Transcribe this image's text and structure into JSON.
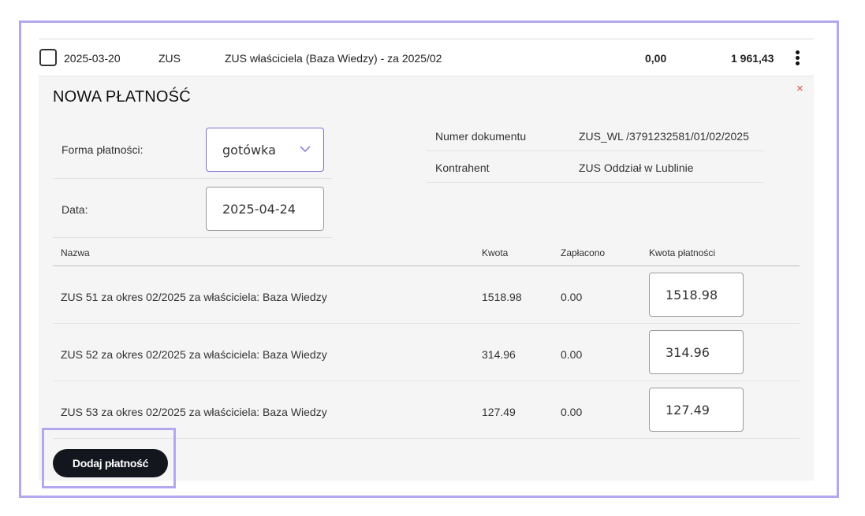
{
  "row": {
    "date": "2025-03-20",
    "type": "ZUS",
    "description": "ZUS właściciela (Baza Wiedzy) - za 2025/02",
    "paid": "0,00",
    "amount": "1 961,43"
  },
  "panel": {
    "title": "NOWA PŁATNOŚĆ",
    "close": "×",
    "payment_form_label": "Forma płatności:",
    "payment_form_value": "gotówka",
    "date_label": "Data:",
    "date_value": "2025-04-24",
    "doc_number_label": "Numer dokumentu",
    "doc_number_value": "ZUS_WL /3791232581/01/02/2025",
    "contractor_label": "Kontrahent",
    "contractor_value": "ZUS Oddział w Lublinie"
  },
  "table": {
    "headers": [
      "Nazwa",
      "Kwota",
      "Zapłacono",
      "Kwota płatności"
    ],
    "rows": [
      {
        "name": "ZUS 51 za okres 02/2025 za właściciela: Baza Wiedzy",
        "amount": "1518.98",
        "paid": "0.00",
        "payment": "1518.98"
      },
      {
        "name": "ZUS 52 za okres 02/2025 za właściciela: Baza Wiedzy",
        "amount": "314.96",
        "paid": "0.00",
        "payment": "314.96"
      },
      {
        "name": "ZUS 53 za okres 02/2025 za właściciela: Baza Wiedzy",
        "amount": "127.49",
        "paid": "0.00",
        "payment": "127.49"
      }
    ]
  },
  "add_button_label": "Dodaj płatność",
  "icons": {
    "checkbox": "checkbox-icon",
    "kebab": "more-vertical-icon",
    "close": "close-icon",
    "chevron": "chevron-down-icon"
  },
  "colors": {
    "highlight": "#b3a8f0",
    "select_border": "#7b6fd6",
    "close": "#e24c4c",
    "button_bg": "#14161d"
  }
}
